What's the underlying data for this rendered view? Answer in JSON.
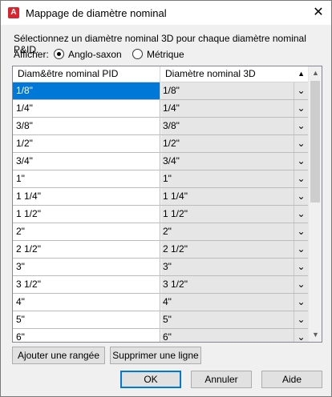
{
  "window": {
    "title": "Mappage de diamètre nominal",
    "icon_letter": "A",
    "close_glyph": "✕"
  },
  "instructions": "Sélectionnez un diamètre nominal 3D pour chaque diamètre nominal P&ID.",
  "display": {
    "label": "Afficher:",
    "options": [
      {
        "label": "Anglo-saxon",
        "selected": true
      },
      {
        "label": "Métrique",
        "selected": false
      }
    ]
  },
  "table": {
    "columns": [
      "Diam&être nominal PID",
      "Diamètre nominal 3D"
    ],
    "sort_glyph": "▲",
    "dropdown_glyph": "⌄",
    "rows": [
      {
        "pid": "1/8\"",
        "d3": "1/8\"",
        "selected": true
      },
      {
        "pid": "1/4\"",
        "d3": "1/4\""
      },
      {
        "pid": "3/8\"",
        "d3": "3/8\""
      },
      {
        "pid": "1/2\"",
        "d3": "1/2\""
      },
      {
        "pid": "3/4\"",
        "d3": "3/4\""
      },
      {
        "pid": "1\"",
        "d3": "1\""
      },
      {
        "pid": "1 1/4\"",
        "d3": "1 1/4\""
      },
      {
        "pid": "1 1/2\"",
        "d3": "1 1/2\""
      },
      {
        "pid": "2\"",
        "d3": "2\""
      },
      {
        "pid": "2 1/2\"",
        "d3": "2 1/2\""
      },
      {
        "pid": "3\"",
        "d3": "3\""
      },
      {
        "pid": "3 1/2\"",
        "d3": "3 1/2\""
      },
      {
        "pid": "4\"",
        "d3": "4\""
      },
      {
        "pid": "5\"",
        "d3": "5\""
      },
      {
        "pid": "6\"",
        "d3": "6\""
      }
    ]
  },
  "buttons": {
    "add_row": "Ajouter une rangée",
    "delete_row": "Supprimer une ligne",
    "ok": "OK",
    "cancel": "Annuler",
    "help": "Aide"
  }
}
